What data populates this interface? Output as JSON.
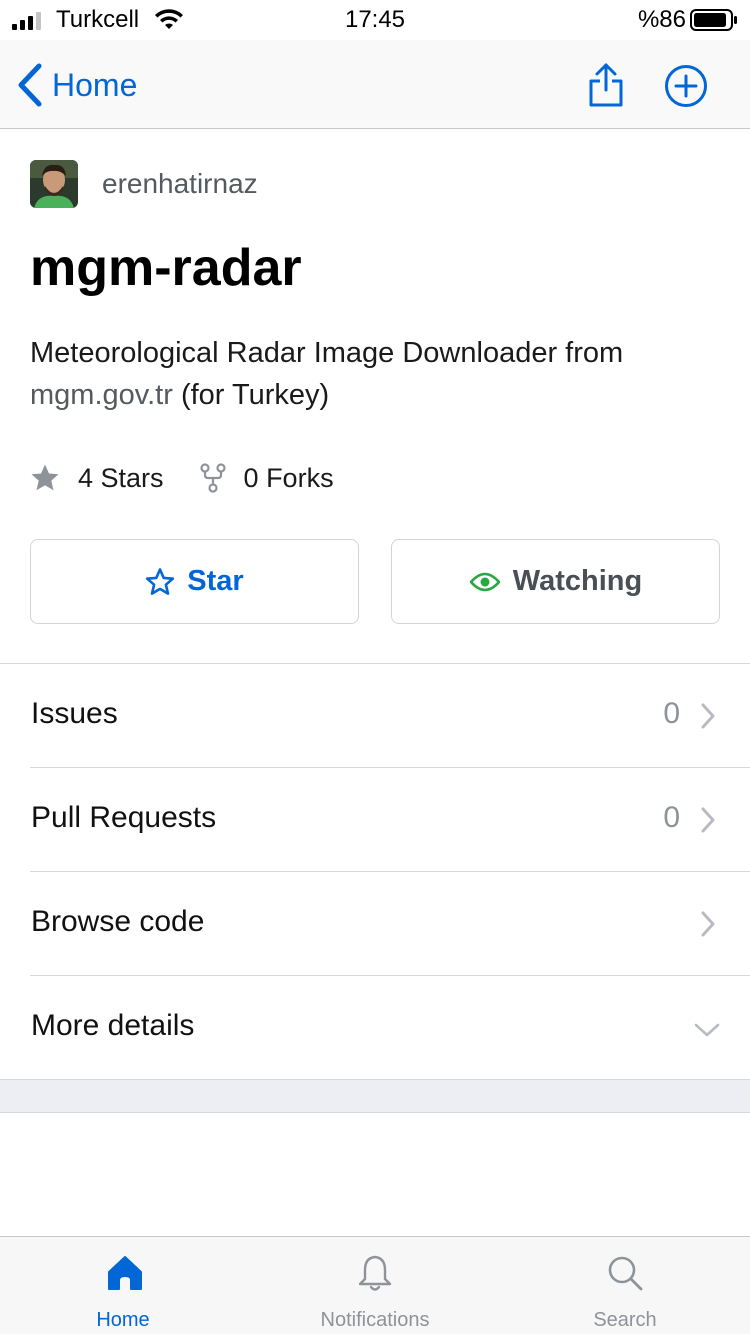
{
  "status_bar": {
    "carrier": "Turkcell",
    "time": "17:45",
    "battery_percent": "%86"
  },
  "nav": {
    "back_label": "Home"
  },
  "repo": {
    "owner": "erenhatirnaz",
    "name": "mgm-radar",
    "description_before": "Meteorological Radar Image Downloader from ",
    "description_link": "mgm.gov.tr",
    "description_after": " (for Turkey)",
    "stars_label": "4 Stars",
    "forks_label": "0 Forks"
  },
  "actions": {
    "star_label": "Star",
    "watch_label": "Watching"
  },
  "rows": {
    "issues": {
      "label": "Issues",
      "count": "0"
    },
    "pull_requests": {
      "label": "Pull Requests",
      "count": "0"
    },
    "browse_code": {
      "label": "Browse code"
    },
    "more_details": {
      "label": "More details"
    }
  },
  "tabs": {
    "home": "Home",
    "notifications": "Notifications",
    "search": "Search"
  },
  "colors": {
    "accent": "#0366d6",
    "watch_icon": "#28a745",
    "muted": "#8e9399"
  }
}
